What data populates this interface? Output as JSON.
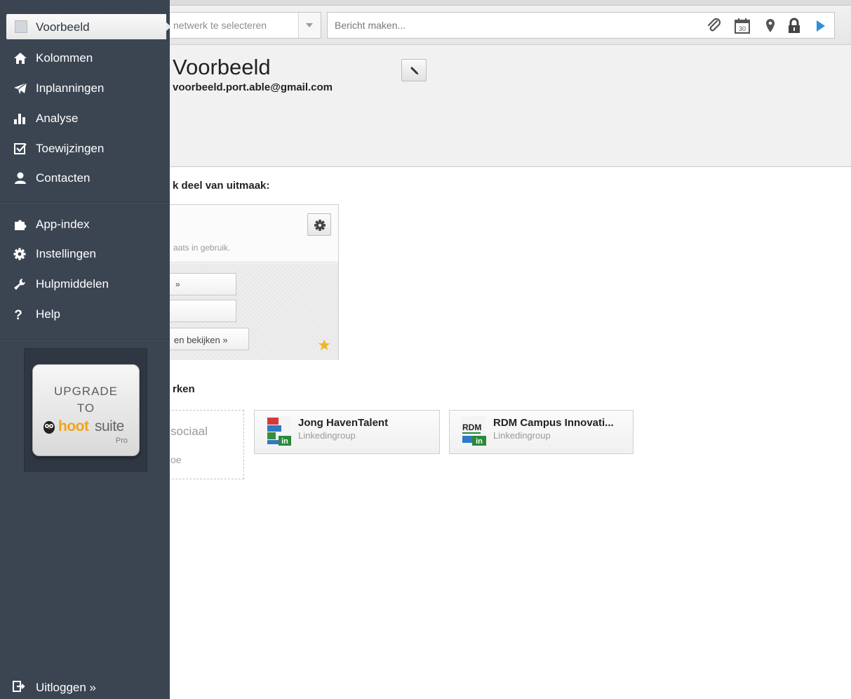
{
  "compose": {
    "network_placeholder": "netwerk te selecteren",
    "message_placeholder": "Bericht maken..."
  },
  "profile": {
    "name": "Voorbeeld",
    "email": "voorbeeld.port.able@gmail.com"
  },
  "organization": {
    "title": "k deel van uitmaak:",
    "seats_text": "aats in gebruik.",
    "button1_label": "»",
    "button3_label": "en bekijken »"
  },
  "networks": {
    "title": "rken",
    "add_line1": "sociaal",
    "add_line2": "oe",
    "items": [
      {
        "name": "Jong HavenTalent",
        "type": "Linkedingroup"
      },
      {
        "name": "RDM Campus Innovati...",
        "type": "Linkedingroup"
      }
    ]
  },
  "nav": {
    "active_label": "Voorbeeld",
    "items": [
      {
        "label": "Kolommen",
        "icon": "home-icon"
      },
      {
        "label": "Inplanningen",
        "icon": "paper-plane-icon"
      },
      {
        "label": "Analyse",
        "icon": "bar-chart-icon"
      },
      {
        "label": "Toewijzingen",
        "icon": "checkbox-icon"
      },
      {
        "label": "Contacten",
        "icon": "person-icon"
      },
      {
        "label": "App-index",
        "icon": "puzzle-icon"
      },
      {
        "label": "Instellingen",
        "icon": "gear-icon"
      },
      {
        "label": "Hulpmiddelen",
        "icon": "wrench-icon"
      },
      {
        "label": "Help",
        "icon": "question-icon"
      }
    ],
    "logout_label": "Uitloggen »"
  },
  "upgrade": {
    "line1": "UPGRADE",
    "line2": "TO",
    "brand_hoot": "hoot",
    "brand_suite": "suite",
    "pro": "Pro"
  },
  "colors": {
    "sidebar": "#3b4552",
    "brand_orange": "#f2a41a",
    "star": "#f0b323",
    "send_blue": "#2f8fd6"
  }
}
